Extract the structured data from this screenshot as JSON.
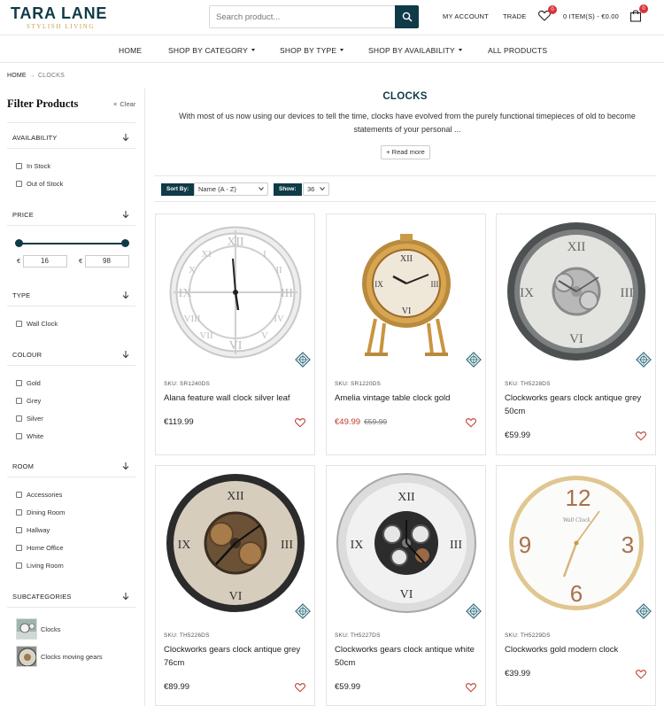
{
  "header": {
    "logo_main": "TARA LANE",
    "logo_tagline": "STYLISH LIVING",
    "search_placeholder": "Search product...",
    "my_account": "MY ACCOUNT",
    "trade": "TRADE",
    "wishlist_count": "0",
    "cart_summary": "0 ITEM(S) - €0.00",
    "cart_count": "0"
  },
  "nav": [
    {
      "label": "HOME",
      "dropdown": false
    },
    {
      "label": "SHOP BY CATEGORY",
      "dropdown": true
    },
    {
      "label": "SHOP BY TYPE",
      "dropdown": true
    },
    {
      "label": "SHOP BY AVAILABILITY",
      "dropdown": true
    },
    {
      "label": "ALL PRODUCTS",
      "dropdown": false
    }
  ],
  "breadcrumb": {
    "home": "HOME",
    "separator": "→",
    "current": "CLOCKS"
  },
  "sidebar": {
    "title": "Filter Products",
    "clear": "Clear",
    "availability": {
      "heading": "AVAILABILITY",
      "options": [
        "In Stock",
        "Out of Stock"
      ]
    },
    "price": {
      "heading": "PRICE",
      "currency": "€",
      "min": "16",
      "max": "98"
    },
    "type": {
      "heading": "TYPE",
      "options": [
        "Wall Clock"
      ]
    },
    "colour": {
      "heading": "COLOUR",
      "options": [
        "Gold",
        "Grey",
        "Silver",
        "White"
      ]
    },
    "room": {
      "heading": "ROOM",
      "options": [
        "Accessories",
        "Dining Room",
        "Hallway",
        "Home Office",
        "Living Room"
      ]
    },
    "subcategories": {
      "heading": "SUBCATEGORIES",
      "items": [
        "Clocks",
        "Clocks moving gears"
      ]
    }
  },
  "main": {
    "title": "CLOCKS",
    "description": "With most of us now using our devices to tell the time, clocks have evolved from the purely functional timepieces of old to become statements of your personal ...",
    "read_more": "+ Read more",
    "sort_label": "Sort By:",
    "sort_value": "Name (A - Z)",
    "show_label": "Show:",
    "show_value": "36"
  },
  "products": [
    {
      "sku": "SKU: SR1240DS",
      "name": "Alana feature wall clock silver leaf",
      "price": "€119.99",
      "old_price": "",
      "sale": false
    },
    {
      "sku": "SKU: SR1220DS",
      "name": "Amelia vintage table clock gold",
      "price": "€49.99",
      "old_price": "€59.99",
      "sale": true
    },
    {
      "sku": "SKU: TH5228DS",
      "name": "Clockworks gears clock antique grey 50cm",
      "price": "€59.99",
      "old_price": "",
      "sale": false
    },
    {
      "sku": "SKU: TH5226DS",
      "name": "Clockworks gears clock antique grey 76cm",
      "price": "€89.99",
      "old_price": "",
      "sale": false
    },
    {
      "sku": "SKU: TH5227DS",
      "name": "Clockworks gears clock antique white 50cm",
      "price": "€59.99",
      "old_price": "",
      "sale": false
    },
    {
      "sku": "SKU: TH5229DS",
      "name": "Clockworks gold modern clock",
      "price": "€39.99",
      "old_price": "",
      "sale": false
    }
  ],
  "colors": {
    "brand": "#0f3a47",
    "accent_gold": "#c9a14a",
    "badge": "#d7343a",
    "sale": "#c0392b",
    "heart": "#c0392b"
  }
}
